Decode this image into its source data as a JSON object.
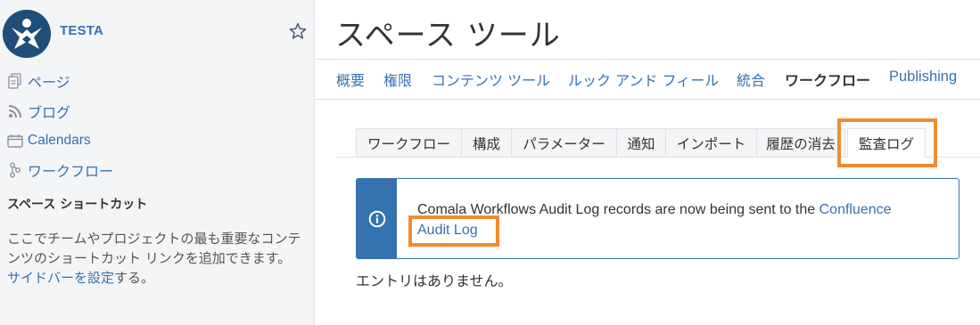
{
  "sidebar": {
    "space_name": "TESTA",
    "nav": [
      {
        "label": "ページ",
        "icon": "page-icon"
      },
      {
        "label": "ブログ",
        "icon": "rss-icon"
      },
      {
        "label": "Calendars",
        "icon": "calendar-icon"
      },
      {
        "label": "ワークフロー",
        "icon": "workflow-icon"
      }
    ],
    "shortcuts_title": "スペース ショートカット",
    "shortcuts_text": "ここでチームやプロジェクトの最も重要なコンテンツのショートカット リンクを追加できます。",
    "shortcuts_link": "サイドバーを設定",
    "shortcuts_suffix": "する。"
  },
  "main": {
    "title": "スペース ツール",
    "topnav": [
      "概要",
      "権限",
      "コンテンツ ツール",
      "ルック アンド フィール",
      "統合",
      "ワークフロー",
      "Publishing"
    ],
    "topnav_active": "ワークフロー",
    "subtabs": [
      "ワークフロー",
      "構成",
      "パラメーター",
      "通知",
      "インポート",
      "履歴の消去",
      "監査ログ"
    ],
    "subtab_active": "監査ログ",
    "info": {
      "text": "Comala Workflows Audit Log records are now being sent to the ",
      "link_part1": "Confluence",
      "link_part2": "Audit Log"
    },
    "empty_text": "エントリはありません。"
  },
  "colors": {
    "link": "#3572b0",
    "highlight": "#f08c2e",
    "logo_bg": "#1f4e7a"
  }
}
